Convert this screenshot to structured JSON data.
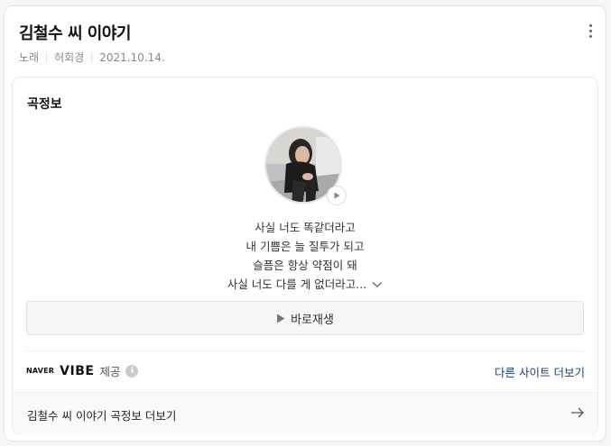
{
  "header": {
    "title": "김철수 씨 이야기",
    "meta": [
      "노래",
      "허회경",
      "2021.10.14."
    ]
  },
  "lyrics_section": {
    "title": "곡정보",
    "lines": [
      "사실 너도 똑같더라고",
      "내 기쁨은 늘 질투가 되고",
      "슬픔은 항상 약점이 돼",
      "사실 너도 다를 게 없더라고..."
    ],
    "play_label": "바로재생",
    "provider_brand_small": "NAVER",
    "provider_brand": "VIBE",
    "provider_suffix": "제공",
    "other_site_label": "다른 사이트 더보기",
    "more_link": "김철수 씨 이야기 곡정보 더보기"
  },
  "icons": {
    "more": "more-vertical-icon",
    "play": "play-icon",
    "info": "info-icon",
    "chevron": "chevron-down-icon",
    "arrow": "arrow-right-icon"
  },
  "colors": {
    "accent_link": "#1a3f7a",
    "text_primary": "#111111",
    "text_meta": "#888888"
  }
}
